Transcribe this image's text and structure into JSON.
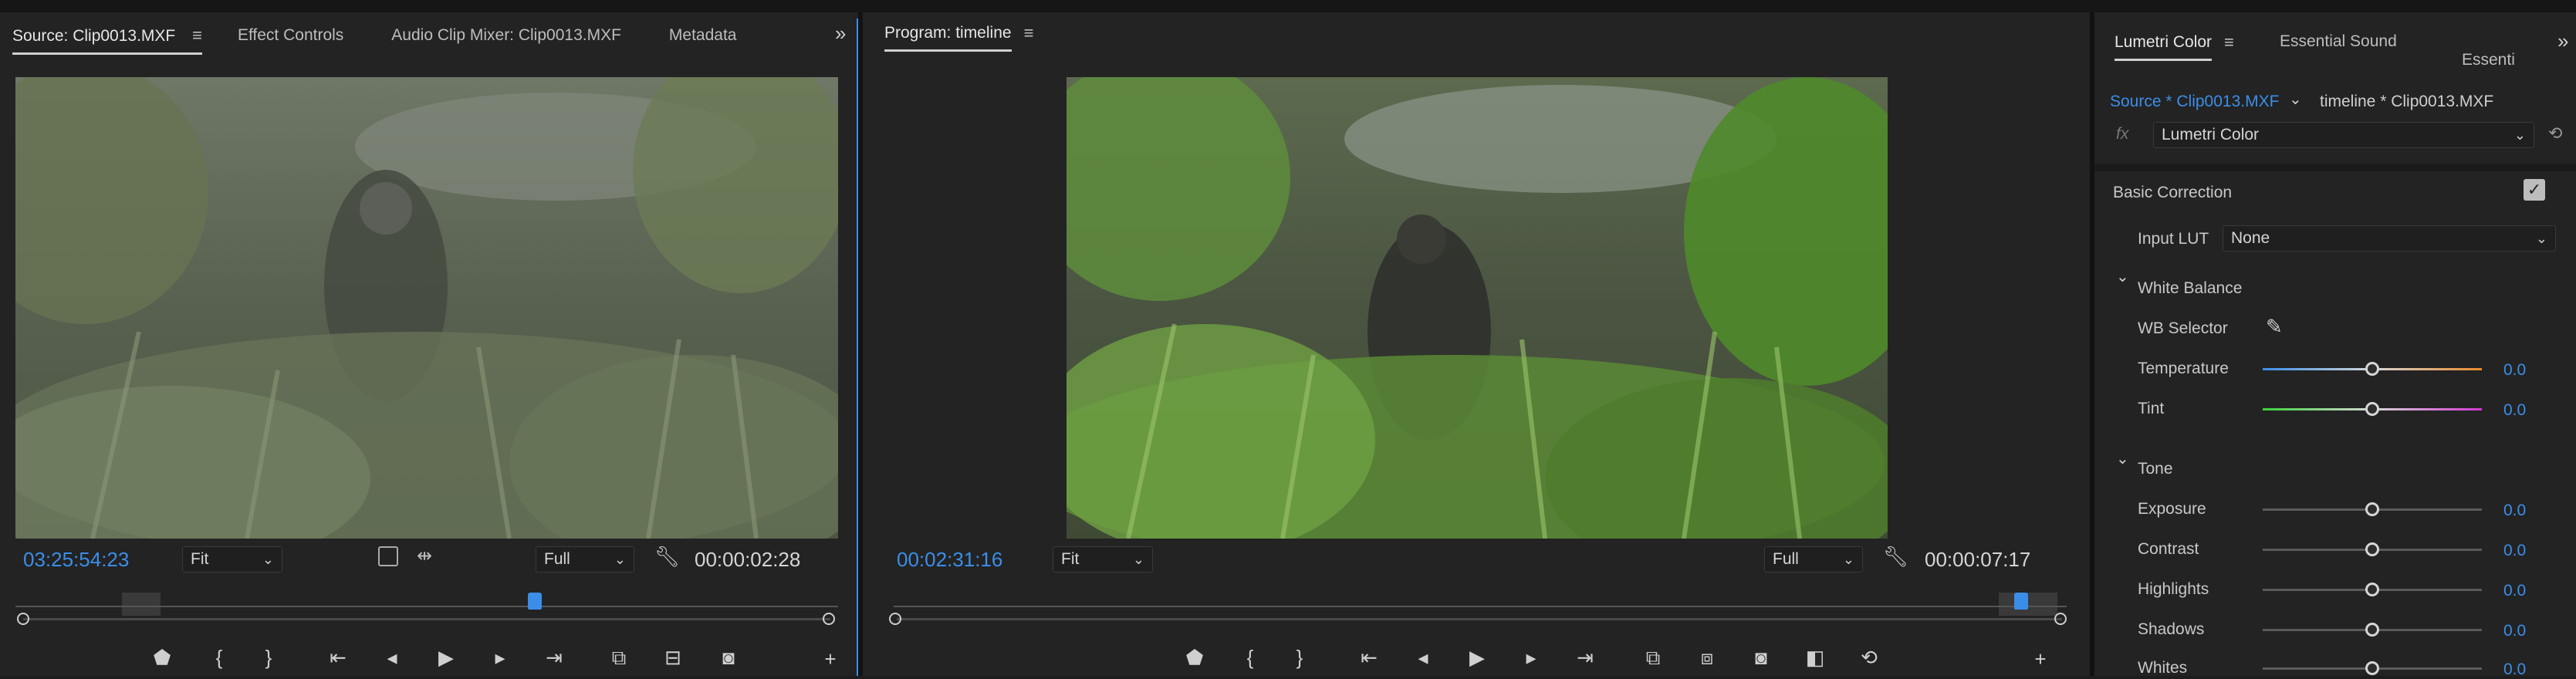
{
  "colors": {
    "accent": "#3b8ee8",
    "panel_bg": "#232323",
    "app_bg": "#1d1d1d"
  },
  "source_panel": {
    "tabs": [
      "Source: Clip0013.MXF",
      "Effect Controls",
      "Audio Clip Mixer: Clip0013.MXF",
      "Metadata"
    ],
    "overflow_icon": "double-chevron-right-icon",
    "timecode_current": "03:25:54:23",
    "zoom": "Fit",
    "resolution": "Full",
    "duration": "00:00:02:28"
  },
  "program_panel": {
    "title": "Program: timeline",
    "timecode_current": "00:02:31:16",
    "zoom": "Fit",
    "resolution": "Full",
    "duration": "00:00:07:17"
  },
  "lumetri_panel": {
    "tabs": [
      "Lumetri Color",
      "Essential Sound",
      "Essenti"
    ],
    "source_tab": "Source * Clip0013.MXF",
    "timeline_tab": "timeline * Clip0013.MXF",
    "fx_label": "fx",
    "effect_select": "Lumetri Color",
    "basic_correction": "Basic Correction",
    "input_lut_label": "Input LUT",
    "input_lut_value": "None",
    "white_balance": "White Balance",
    "wb_selector": "WB Selector",
    "temperature": {
      "label": "Temperature",
      "value": "0.0",
      "level": 0.5
    },
    "tint": {
      "label": "Tint",
      "value": "0.0",
      "level": 0.5
    },
    "tone": "Tone",
    "exposure": {
      "label": "Exposure",
      "value": "0.0",
      "level": 0.5
    },
    "contrast": {
      "label": "Contrast",
      "value": "0.0",
      "level": 0.5
    },
    "highlights": {
      "label": "Highlights",
      "value": "0.0",
      "level": 0.5
    },
    "shadows": {
      "label": "Shadows",
      "value": "0.0",
      "level": 0.5
    },
    "whites": {
      "label": "Whites",
      "value": "0.0",
      "level": 0.5
    }
  }
}
